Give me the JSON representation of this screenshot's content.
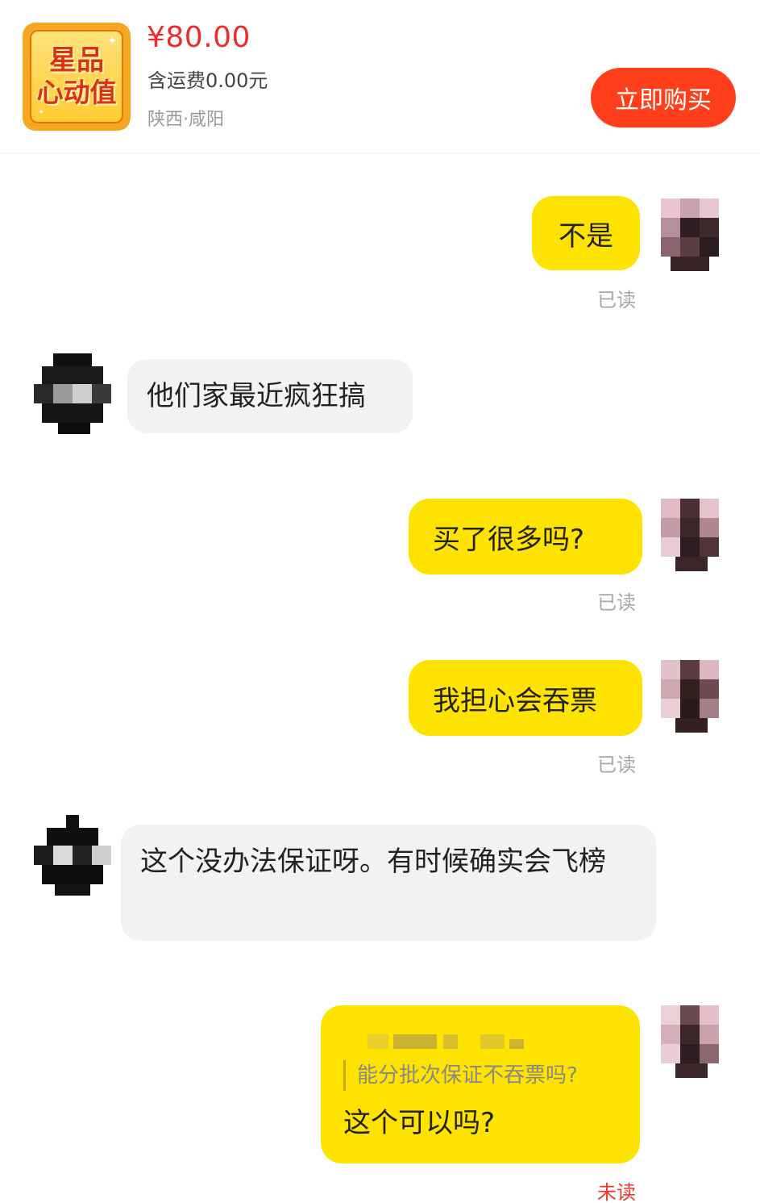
{
  "product": {
    "thumb_line1": "星品",
    "thumb_line2": "心动值",
    "price": "¥80.00",
    "shipping": "含运费0.00元",
    "location": "陕西·咸阳",
    "buy_label": "立即购买"
  },
  "messages": [
    {
      "side": "out",
      "text": "不是",
      "status": "已读"
    },
    {
      "side": "in",
      "text": "他们家最近疯狂搞"
    },
    {
      "side": "out",
      "text": "买了很多吗?",
      "status": "已读"
    },
    {
      "side": "out",
      "text": "我担心会吞票",
      "status": "已读"
    },
    {
      "side": "in",
      "text": "这个没办法保证呀。有时候确实会飞榜"
    },
    {
      "side": "out",
      "quote": "能分批次保证不吞票吗?",
      "text": "这个可以吗?",
      "status": "未读"
    }
  ],
  "colors": {
    "accent_yellow": "#ffe300",
    "buy_button": "#ff3f1b",
    "price": "#ee2a2a",
    "unread": "#ee3a2a"
  }
}
